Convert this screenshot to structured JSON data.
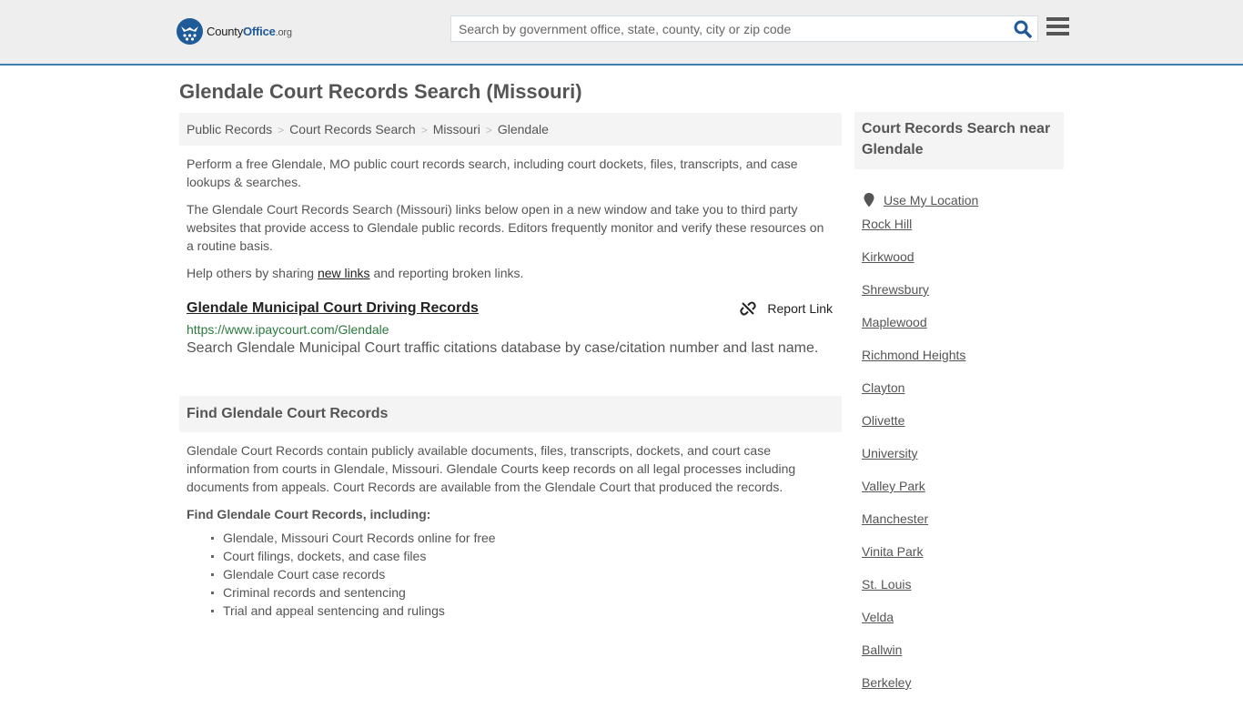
{
  "header": {
    "logo": {
      "county": "County",
      "office": "Office",
      "org": ".org"
    },
    "search": {
      "placeholder": "Search by government office, state, county, city or zip code",
      "value": ""
    },
    "icons": {
      "search": "search-icon",
      "menu": "hamburger-menu-icon"
    }
  },
  "page": {
    "title": "Glendale Court Records Search (Missouri)"
  },
  "breadcrumb": [
    "Public Records",
    "Court Records Search",
    "Missouri",
    "Glendale"
  ],
  "intro": {
    "p1": "Perform a free Glendale, MO public court records search, including court dockets, files, transcripts, and case lookups & searches.",
    "p2": "The Glendale Court Records Search (Missouri) links below open in a new window and take you to third party websites that provide access to Glendale public records. Editors frequently monitor and verify these resources on a routine basis.",
    "p3_before": "Help others by sharing ",
    "p3_link": "new links",
    "p3_after": " and reporting broken links."
  },
  "results": [
    {
      "title": "Glendale Municipal Court Driving Records",
      "url": "https://www.ipaycourt.com/Glendale",
      "description": "Search Glendale Municipal Court traffic citations database by case/citation number and last name.",
      "report_label": "Report Link"
    }
  ],
  "find_section": {
    "heading": "Find Glendale Court Records",
    "body": "Glendale Court Records contain publicly available documents, files, transcripts, dockets, and court case information from courts in Glendale, Missouri. Glendale Courts keep records on all legal processes including documents from appeals. Court Records are available from the Glendale Court that produced the records.",
    "subheading": "Find Glendale Court Records, including:",
    "items": [
      "Glendale, Missouri Court Records online for free",
      "Court filings, dockets, and case files",
      "Glendale Court case records",
      "Criminal records and sentencing",
      "Trial and appeal sentencing and rulings"
    ]
  },
  "sidebar": {
    "heading": "Court Records Search near Glendale",
    "use_location": "Use My Location",
    "nearby": [
      "Rock Hill",
      "Kirkwood",
      "Shrewsbury",
      "Maplewood",
      "Richmond Heights",
      "Clayton",
      "Olivette",
      "University",
      "Valley Park",
      "Manchester",
      "Vinita Park",
      "St. Louis",
      "Velda",
      "Ballwin",
      "Berkeley"
    ]
  },
  "colors": {
    "brand": "#1f5a99",
    "header_border": "#3d7eae",
    "url_green": "#2b7a3e"
  }
}
